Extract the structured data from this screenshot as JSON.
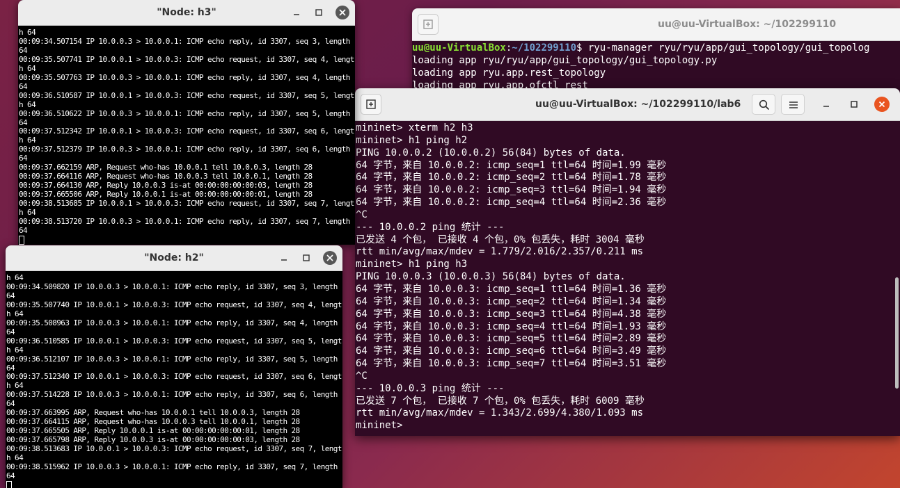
{
  "back_terminal": {
    "title": "uu@uu-VirtualBox: ~/102299110",
    "prompt_user": "uu@uu-VirtualBox",
    "prompt_sep": ":",
    "prompt_path": "~/102299110",
    "prompt_cmd": "$ ryu-manager ryu/ryu/app/gui_topology/gui_topolog",
    "lines": [
      "loading app ryu/ryu/app/gui_topology/gui_topology.py",
      "loading app ryu.app.rest_topology",
      "loading app ryu.app.ofctl_rest"
    ]
  },
  "front_terminal": {
    "title": "uu@uu-VirtualBox: ~/102299110/lab6",
    "lines": [
      "mininet> xterm h2 h3",
      "mininet> h1 ping h2",
      "PING 10.0.0.2 (10.0.0.2) 56(84) bytes of data.",
      "64 字节，来自 10.0.0.2: icmp_seq=1 ttl=64 时间=1.99 毫秒",
      "64 字节，来自 10.0.0.2: icmp_seq=2 ttl=64 时间=1.78 毫秒",
      "64 字节，来自 10.0.0.2: icmp_seq=3 ttl=64 时间=1.94 毫秒",
      "64 字节，来自 10.0.0.2: icmp_seq=4 ttl=64 时间=2.36 毫秒",
      "^C",
      "--- 10.0.0.2 ping 统计 ---",
      "已发送 4 个包， 已接收 4 个包，0% 包丢失，耗时 3004 毫秒",
      "rtt min/avg/max/mdev = 1.779/2.016/2.357/0.211 ms",
      "mininet> h1 ping h3",
      "PING 10.0.0.3 (10.0.0.3) 56(84) bytes of data.",
      "64 字节，来自 10.0.0.3: icmp_seq=1 ttl=64 时间=1.36 毫秒",
      "64 字节，来自 10.0.0.3: icmp_seq=2 ttl=64 时间=1.34 毫秒",
      "64 字节，来自 10.0.0.3: icmp_seq=3 ttl=64 时间=4.38 毫秒",
      "64 字节，来自 10.0.0.3: icmp_seq=4 ttl=64 时间=1.93 毫秒",
      "64 字节，来自 10.0.0.3: icmp_seq=5 ttl=64 时间=2.89 毫秒",
      "64 字节，来自 10.0.0.3: icmp_seq=6 ttl=64 时间=3.49 毫秒",
      "64 字节，来自 10.0.0.3: icmp_seq=7 ttl=64 时间=3.51 毫秒",
      "^C",
      "--- 10.0.0.3 ping 统计 ---",
      "已发送 7 个包， 已接收 7 个包，0% 包丢失，耗时 6009 毫秒",
      "rtt min/avg/max/mdev = 1.343/2.699/4.380/1.093 ms",
      "mininet> "
    ]
  },
  "xterm_h3": {
    "title": "\"Node: h3\"",
    "lines": [
      "h 64",
      "00:09:34.507154 IP 10.0.0.3 > 10.0.0.1: ICMP echo reply, id 3307, seq 3, length",
      "64",
      "00:09:35.507741 IP 10.0.0.1 > 10.0.0.3: ICMP echo request, id 3307, seq 4, lengt",
      "h 64",
      "00:09:35.507763 IP 10.0.0.3 > 10.0.0.1: ICMP echo reply, id 3307, seq 4, length",
      "64",
      "00:09:36.510587 IP 10.0.0.1 > 10.0.0.3: ICMP echo request, id 3307, seq 5, lengt",
      "h 64",
      "00:09:36.510622 IP 10.0.0.3 > 10.0.0.1: ICMP echo reply, id 3307, seq 5, length",
      "64",
      "00:09:37.512342 IP 10.0.0.1 > 10.0.0.3: ICMP echo request, id 3307, seq 6, lengt",
      "h 64",
      "00:09:37.512379 IP 10.0.0.3 > 10.0.0.1: ICMP echo reply, id 3307, seq 6, length",
      "64",
      "00:09:37.662159 ARP, Request who-has 10.0.0.1 tell 10.0.0.3, length 28",
      "00:09:37.664116 ARP, Request who-has 10.0.0.3 tell 10.0.0.1, length 28",
      "00:09:37.664130 ARP, Reply 10.0.0.3 is-at 00:00:00:00:00:03, length 28",
      "00:09:37.665506 ARP, Reply 10.0.0.1 is-at 00:00:00:00:00:01, length 28",
      "00:09:38.513685 IP 10.0.0.1 > 10.0.0.3: ICMP echo request, id 3307, seq 7, lengt",
      "h 64",
      "00:09:38.513720 IP 10.0.0.3 > 10.0.0.1: ICMP echo reply, id 3307, seq 7, length",
      "64"
    ]
  },
  "xterm_h2": {
    "title": "\"Node: h2\"",
    "lines": [
      "h 64",
      "00:09:34.509820 IP 10.0.0.3 > 10.0.0.1: ICMP echo reply, id 3307, seq 3, length",
      "64",
      "00:09:35.507740 IP 10.0.0.1 > 10.0.0.3: ICMP echo request, id 3307, seq 4, lengt",
      "h 64",
      "00:09:35.508963 IP 10.0.0.3 > 10.0.0.1: ICMP echo reply, id 3307, seq 4, length",
      "64",
      "00:09:36.510585 IP 10.0.0.1 > 10.0.0.3: ICMP echo request, id 3307, seq 5, lengt",
      "h 64",
      "00:09:36.512107 IP 10.0.0.3 > 10.0.0.1: ICMP echo reply, id 3307, seq 5, length",
      "64",
      "00:09:37.512340 IP 10.0.0.1 > 10.0.0.3: ICMP echo request, id 3307, seq 6, lengt",
      "h 64",
      "00:09:37.514228 IP 10.0.0.3 > 10.0.0.1: ICMP echo reply, id 3307, seq 6, length",
      "64",
      "00:09:37.663995 ARP, Request who-has 10.0.0.1 tell 10.0.0.3, length 28",
      "00:09:37.664115 ARP, Request who-has 10.0.0.3 tell 10.0.0.1, length 28",
      "00:09:37.665505 ARP, Reply 10.0.0.1 is-at 00:00:00:00:00:01, length 28",
      "00:09:37.665798 ARP, Reply 10.0.0.3 is-at 00:00:00:00:00:03, length 28",
      "00:09:38.513683 IP 10.0.0.1 > 10.0.0.3: ICMP echo request, id 3307, seq 7, lengt",
      "h 64",
      "00:09:38.515962 IP 10.0.0.3 > 10.0.0.1: ICMP echo reply, id 3307, seq 7, length",
      "64"
    ]
  },
  "colors": {
    "terminal_bg": "#300a24",
    "xterm_bg": "#000000",
    "prompt_user": "#8ae234",
    "prompt_path": "#729fcf",
    "close_accent": "#e95420"
  },
  "icons": {
    "new_tab": "new-tab-icon",
    "search": "search-icon",
    "menu": "hamburger-menu-icon",
    "minimize": "minimize-icon",
    "maximize": "maximize-icon",
    "close": "close-icon"
  }
}
